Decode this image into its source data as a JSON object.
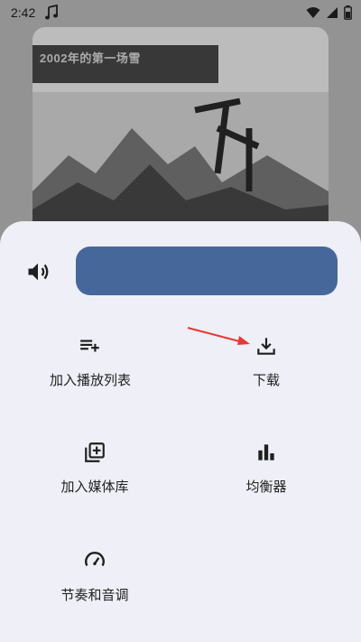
{
  "status_bar": {
    "time": "2:42",
    "icons": [
      "music-note-icon",
      "wifi-icon",
      "signal-icon",
      "battery-icon"
    ]
  },
  "album": {
    "banner_text": "2002年的第一场雪"
  },
  "sheet": {
    "volume_icon": "volume-icon",
    "volume_level": 1.0,
    "items": [
      {
        "label": "加入播放列表",
        "icon": "playlist-add-icon"
      },
      {
        "label": "下载",
        "icon": "download-icon"
      },
      {
        "label": "加入媒体库",
        "icon": "library-add-icon"
      },
      {
        "label": "均衡器",
        "icon": "equalizer-icon"
      },
      {
        "label": "节奏和音调",
        "icon": "speed-icon"
      }
    ]
  },
  "colors": {
    "sheet_bg": "#eeeff7",
    "slider": "#46679a",
    "arrow": "#e53935"
  }
}
